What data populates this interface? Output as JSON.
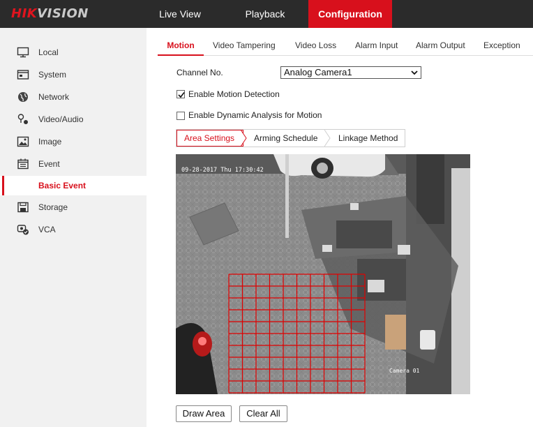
{
  "header": {
    "logo_primary": "HIK",
    "logo_secondary": "VISION",
    "nav": [
      "Live View",
      "Playback",
      "Configuration"
    ]
  },
  "sidebar": {
    "items": [
      {
        "label": "Local",
        "icon": "monitor-icon"
      },
      {
        "label": "System",
        "icon": "system-icon"
      },
      {
        "label": "Network",
        "icon": "globe-icon"
      },
      {
        "label": "Video/Audio",
        "icon": "mic-icon"
      },
      {
        "label": "Image",
        "icon": "image-icon"
      },
      {
        "label": "Event",
        "icon": "calendar-icon"
      },
      {
        "label": "Basic Event",
        "icon": ""
      },
      {
        "label": "Storage",
        "icon": "floppy-icon"
      },
      {
        "label": "VCA",
        "icon": "vca-icon"
      }
    ],
    "active": "Basic Event"
  },
  "tabs": [
    "Motion",
    "Video Tampering",
    "Video Loss",
    "Alarm Input",
    "Alarm Output",
    "Exception"
  ],
  "active_tab": "Motion",
  "form": {
    "channel_label": "Channel No.",
    "channel_value": "Analog Camera1",
    "enable_motion_label": "Enable Motion Detection",
    "enable_motion_checked": true,
    "enable_dynamic_label": "Enable Dynamic Analysis for Motion",
    "enable_dynamic_checked": false
  },
  "steps": [
    "Area Settings",
    "Arming Schedule",
    "Linkage Method"
  ],
  "active_step": "Area Settings",
  "video": {
    "timestamp": "09-28-2017 Thu 17:30:42",
    "camera_label": "Camera 01",
    "grid_color": "#e00000"
  },
  "buttons": {
    "draw_area": "Draw Area",
    "clear_all": "Clear All"
  },
  "colors": {
    "accent": "#d8101c",
    "topbar": "#2b2b2b",
    "sidebar": "#f1f1f1"
  }
}
